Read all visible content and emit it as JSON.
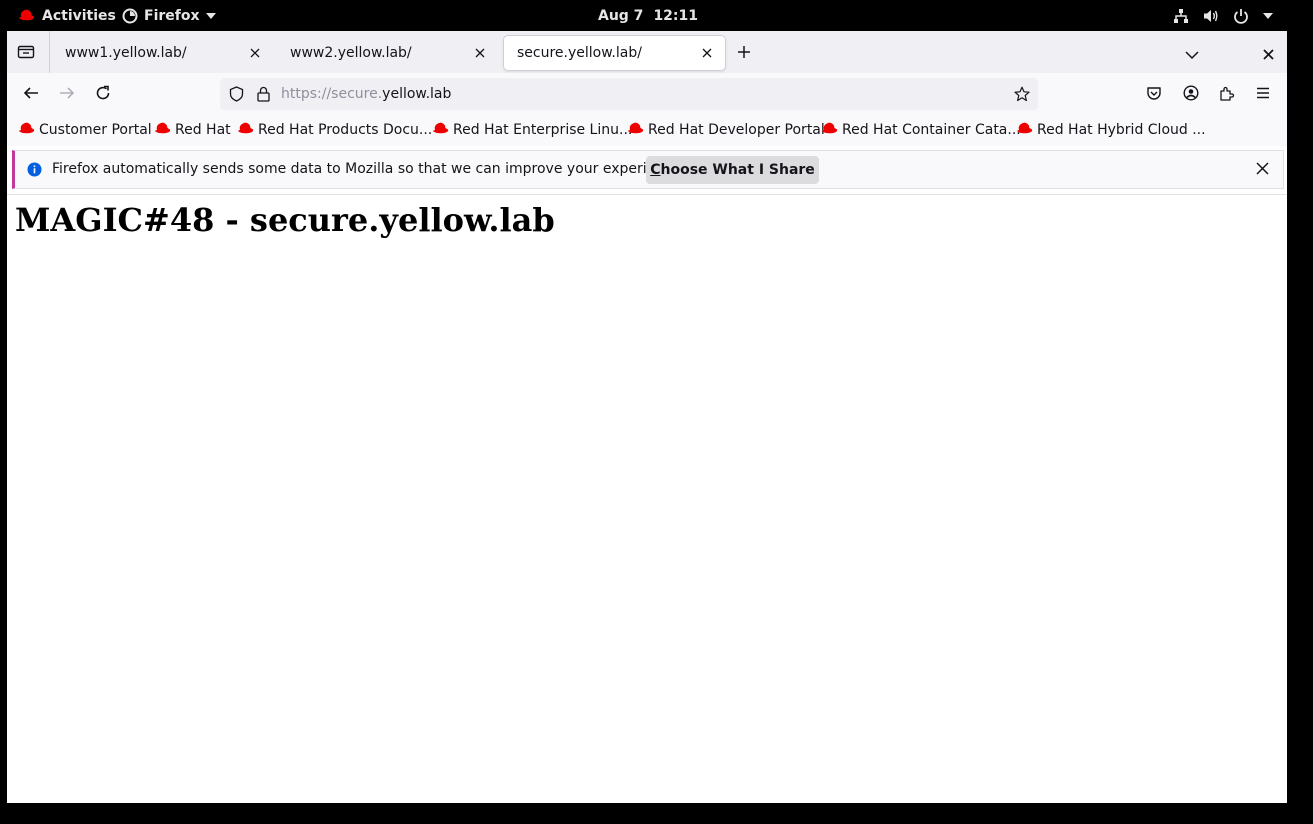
{
  "topbar": {
    "activities_label": "Activities",
    "app_name": "Firefox",
    "date": "Aug 7",
    "time": "12:11"
  },
  "tabs": [
    {
      "title": "www1.yellow.lab/",
      "active": false
    },
    {
      "title": "www2.yellow.lab/",
      "active": false
    },
    {
      "title": "secure.yellow.lab/",
      "active": true
    }
  ],
  "urlbar": {
    "url_prefix": "https://secure.",
    "url_domain": "yellow.lab"
  },
  "bookmarks": [
    "Customer Portal",
    "Red Hat",
    "Red Hat Products Docu...",
    "Red Hat Enterprise Linu...",
    "Red Hat Developer Portal",
    "Red Hat Container Cata...",
    "Red Hat Hybrid Cloud ..."
  ],
  "notification": {
    "message": "Firefox automatically sends some data to Mozilla so that we can improve your experience.",
    "button_first_letter": "C",
    "button_rest": "hoose What I Share"
  },
  "page": {
    "heading": "MAGIC#48 - secure.yellow.lab"
  },
  "colors": {
    "redhat": "#ee0000",
    "notification_accent": "#c2389e",
    "info_blue": "#0060df"
  }
}
